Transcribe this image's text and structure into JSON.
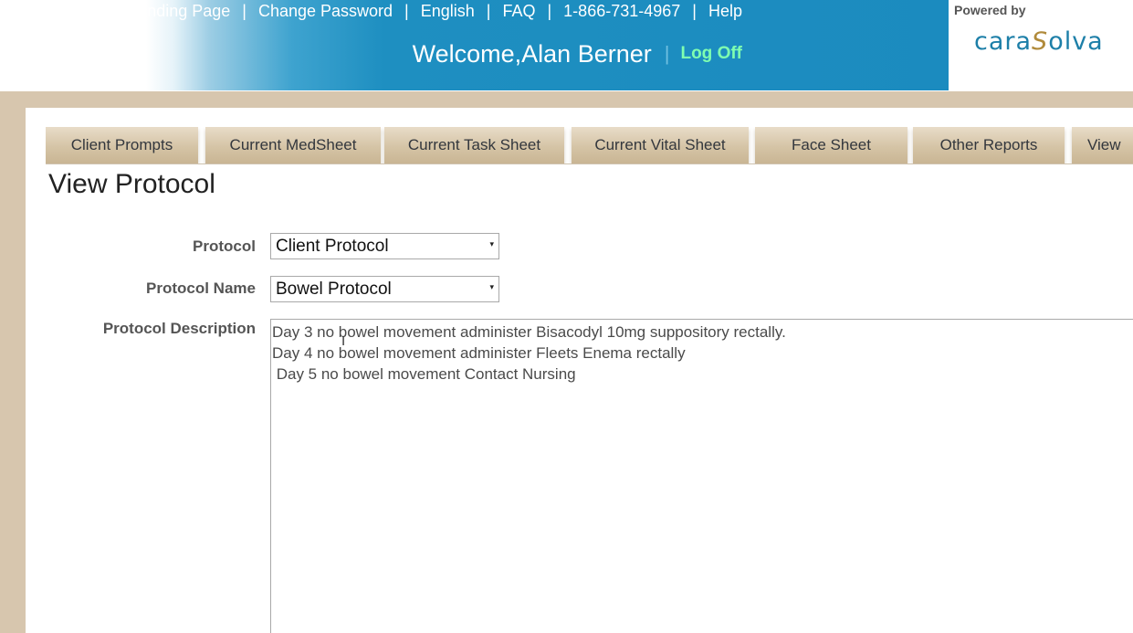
{
  "header": {
    "top_links": [
      "Landing Page",
      "Change Password",
      "English",
      "FAQ",
      "1-866-731-4967",
      "Help"
    ],
    "separator": "|",
    "welcome": "Welcome,Alan Berner",
    "welcome_separator": "|",
    "logoff": "Log Off",
    "powered_by": "Powered by",
    "logo_text_a": "cara",
    "logo_text_s": "S",
    "logo_text_b": "olva"
  },
  "tabs": [
    "Client Prompts",
    "Current MedSheet",
    "Current Task Sheet",
    "Current Vital Sheet",
    "Face Sheet",
    "Other Reports",
    "View"
  ],
  "page_title": "View Protocol",
  "form": {
    "protocol_label": "Protocol",
    "protocol_value": "Client Protocol",
    "protocol_name_label": "Protocol Name",
    "protocol_name_value": "Bowel Protocol",
    "description_label": "Protocol Description",
    "description_lines": [
      "Day 3 no bowel movement administer Bisacodyl 10mg suppository rectally.",
      "Day 4 no bowel movement administer Fleets Enema rectally",
      " Day 5 no bowel movement Contact Nursing"
    ]
  },
  "colors": {
    "header_blue": "#1b8bbf",
    "tab_tan": "#d5c4a6",
    "frame_tan": "#d7c6ae",
    "logoff_green": "#7fffb0"
  }
}
